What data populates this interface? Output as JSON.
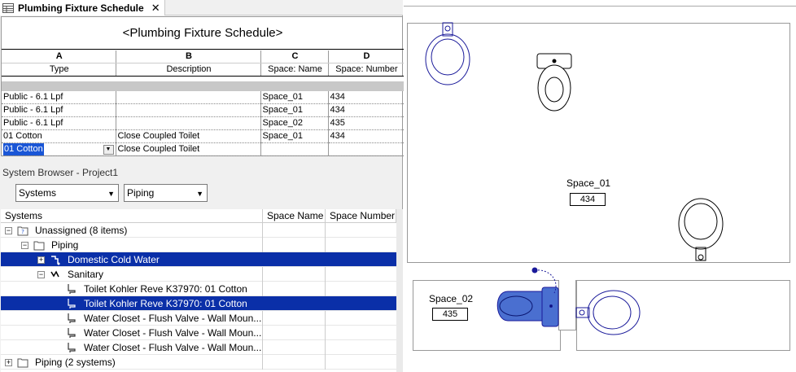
{
  "tab": {
    "title": "Plumbing Fixture Schedule",
    "close_icon": "close-icon"
  },
  "schedule": {
    "title": "<Plumbing Fixture Schedule>",
    "letters": [
      "A",
      "B",
      "C",
      "D"
    ],
    "headers": [
      "Type",
      "Description",
      "Space: Name",
      "Space: Number"
    ],
    "rows": [
      [
        "Public - 6.1 Lpf",
        "",
        "Space_01",
        "434"
      ],
      [
        "Public - 6.1 Lpf",
        "",
        "Space_01",
        "434"
      ],
      [
        "Public - 6.1 Lpf",
        "",
        "Space_02",
        "435"
      ],
      [
        "01 Cotton",
        "Close Coupled Toilet",
        "Space_01",
        "434"
      ]
    ],
    "edit_row": {
      "type": "01 Cotton",
      "description": "Close Coupled Toilet"
    }
  },
  "system_browser": {
    "title": "System Browser - Project1",
    "combo1": "Systems",
    "combo2": "Piping",
    "columns": [
      "Systems",
      "Space Name",
      "Space Number"
    ],
    "items": [
      {
        "label": "Unassigned (8 items)"
      },
      {
        "label": "Piping"
      },
      {
        "label": "Domestic Cold Water"
      },
      {
        "label": "Sanitary"
      },
      {
        "label": "Toilet Kohler Reve K37970: 01 Cotton"
      },
      {
        "label": "Toilet Kohler Reve K37970: 01 Cotton"
      },
      {
        "label": "Water Closet - Flush Valve - Wall Moun..."
      },
      {
        "label": "Water Closet - Flush Valve - Wall Moun..."
      },
      {
        "label": "Water Closet - Flush Valve - Wall Moun..."
      },
      {
        "label": "Piping (2 systems)"
      }
    ]
  },
  "plan": {
    "space1_name": "Space_01",
    "space1_number": "434",
    "space2_name": "Space_02",
    "space2_number": "435"
  },
  "colors": {
    "selection": "#0a2fa8",
    "fixture": "#1a1a9a",
    "fixture_fill": "#4a6fd0"
  }
}
